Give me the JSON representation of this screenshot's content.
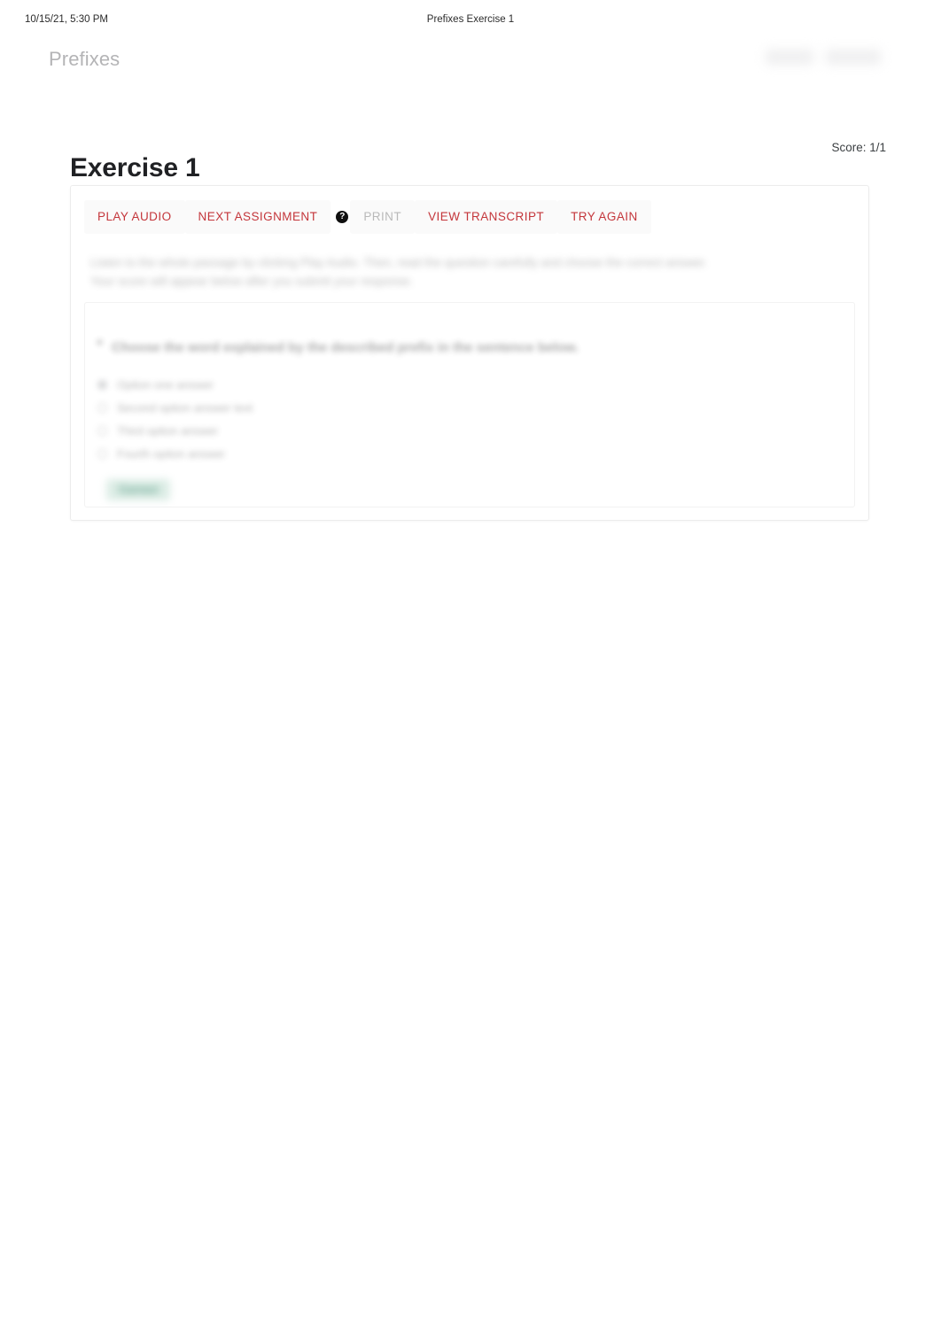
{
  "print_header": {
    "timestamp": "10/15/21, 5:30 PM",
    "document_title": "Prefixes Exercise 1"
  },
  "masthead": {
    "brand": "Prefixes"
  },
  "page": {
    "title": "Exercise 1",
    "score": "Score: 1/1"
  },
  "toolbar": {
    "play_audio_label": "PLAY AUDIO",
    "next_assignment_label": "NEXT ASSIGNMENT",
    "help_icon_glyph": "?",
    "print_label": "PRINT",
    "view_transcript_label": "VIEW TRANSCRIPT",
    "try_again_label": "TRY AGAIN"
  },
  "exercise": {
    "instructions_line_1": "Listen to the whole passage by clicking Play Audio. Then, read the question carefully and choose the correct answer.",
    "instructions_line_2": "Your score will appear below after you submit your response.",
    "question": "Choose the word explained by the described prefix in the sentence below.",
    "options": [
      "Option one answer",
      "Second option answer text",
      "Third option answer",
      "Fourth option answer"
    ],
    "selected_option_index": 0,
    "result_badge": "Correct"
  },
  "colors": {
    "accent_red": "#c4363b",
    "disabled_gray": "#b9b9b9",
    "brand_gray": "#b4b4b6",
    "success_green": "#1f7a5c",
    "success_green_bg": "#cfe6dc"
  }
}
